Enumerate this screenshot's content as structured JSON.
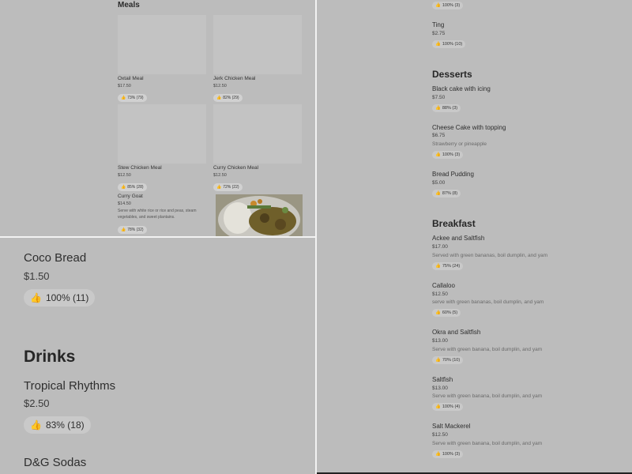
{
  "meals": {
    "title": "Meals",
    "items": [
      {
        "name": "Oxtail Meal",
        "price": "$17.50",
        "rating": "73% (79)"
      },
      {
        "name": "Jerk Chicken Meal",
        "price": "$12.50",
        "rating": "82% (29)"
      },
      {
        "name": "Stew Chicken Meal",
        "price": "$12.50",
        "rating": "85% (28)"
      },
      {
        "name": "Curry Chicken Meal",
        "price": "$12.50",
        "rating": "72% (22)"
      }
    ],
    "curry_goat": {
      "name": "Curry Goat",
      "price": "$14.50",
      "description": "Serve with white rice or rice and peas, steam vegetables, and sweet plantains.",
      "rating": "78% (32)"
    }
  },
  "zoom": {
    "coco_bread": {
      "name": "Coco Bread",
      "price": "$1.50",
      "rating": "100% (11)"
    },
    "drinks_title": "Drinks",
    "tropical": {
      "name": "Tropical Rhythms",
      "price": "$2.50",
      "rating": "83% (18)"
    },
    "dg": {
      "name": "D&G Sodas"
    }
  },
  "right": {
    "top_rating": "100% (3)",
    "ting": {
      "name": "Ting",
      "price": "$2.75",
      "rating": "100% (10)"
    },
    "desserts_title": "Desserts",
    "desserts": [
      {
        "name": "Black cake with icing",
        "price": "$7.50",
        "rating": "88% (3)"
      },
      {
        "name": "Cheese Cake with topping",
        "price": "$6.75",
        "desc": "Strawberry or pineapple",
        "rating": "100% (3)"
      },
      {
        "name": "Bread Pudding",
        "price": "$5.00",
        "rating": "87% (8)"
      }
    ],
    "breakfast_title": "Breakfast",
    "breakfast": [
      {
        "name": "Ackee and Saltfish",
        "price": "$17.00",
        "desc": "Served with green bananas, boil dumplin, and yam",
        "rating": "75% (24)"
      },
      {
        "name": "Callaloo",
        "price": "$12.50",
        "desc": "serve with green bananas, boil dumplin, and yam",
        "rating": "60% (5)"
      },
      {
        "name": "Okra and Saltfish",
        "price": "$13.00",
        "desc": "Serve with green banana, boil dumplin, and yam",
        "rating": "70% (10)"
      },
      {
        "name": "Saltfish",
        "price": "$13.00",
        "desc": "Serve with green banana, boil dumplin, and yam",
        "rating": "100% (4)"
      },
      {
        "name": "Salt Mackerel",
        "price": "$12.50",
        "desc": "Serve with green banana, boil dumplin, and yam",
        "rating": "100% (3)"
      }
    ]
  },
  "icons": {
    "thumbs_up": "thumbs-up-icon"
  },
  "colors": {
    "background": "#bcbcbc",
    "pill": "#c9c9c9",
    "divider": "#f2f2f2"
  }
}
